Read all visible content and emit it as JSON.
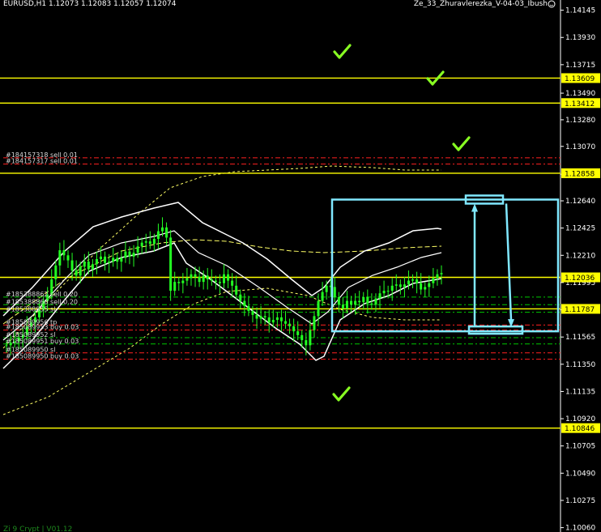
{
  "header": {
    "symbol_line": "EURUSD,H1  1.12073 1.12083 1.12057 1.12074",
    "ea_name": "Ze_33_Zhuravlerezka_V-04-03_Ibush",
    "face_icon": "smiley-icon"
  },
  "footer": {
    "text": "Zi 9 Crypt | V01.12"
  },
  "colors": {
    "background": "#000000",
    "axis_text": "#ffffff",
    "level_line": "#ffff00",
    "bollinger": "#ffffff",
    "ma_dashed": "#ffff66",
    "candles": "#22ff22",
    "order_green": "#00c800",
    "order_red": "#ff2020",
    "box": "#80e8ff",
    "check": "#88ff22"
  },
  "chart_data": {
    "type": "candlestick",
    "symbol": "EURUSD",
    "timeframe": "H1",
    "ylim": [
      1.1,
      1.142
    ],
    "y_ticks": [
      "1.14145",
      "1.13930",
      "1.13715",
      "1.13490",
      "1.13280",
      "1.13070",
      "1.12850",
      "1.12640",
      "1.12425",
      "1.12210",
      "1.11995",
      "1.11780",
      "1.11565",
      "1.11350",
      "1.11135",
      "1.10920",
      "1.10705",
      "1.10490",
      "1.10275",
      "1.10060"
    ],
    "levels": [
      {
        "price": 1.13609,
        "label": "1.13609"
      },
      {
        "price": 1.13412,
        "label": "1.13412"
      },
      {
        "price": 1.12858,
        "label": "1.12858"
      },
      {
        "price": 1.12036,
        "label": "1.12036"
      },
      {
        "price": 1.11787,
        "label": "1.11787"
      },
      {
        "price": 1.10846,
        "label": "1.10846"
      }
    ],
    "orders": [
      {
        "label": "#184157318 sell 0.01",
        "price": 1.1298,
        "color": "red"
      },
      {
        "label": "#184157317 sell 0.01",
        "price": 1.1293,
        "color": "red"
      },
      {
        "label": "#185388862 sell 0.20",
        "price": 1.1188,
        "color": "green"
      },
      {
        "label": "#185388860 sell 0.20",
        "price": 1.1182,
        "color": "green"
      },
      {
        "label": "#185388855 sl",
        "price": 1.1176,
        "color": "green"
      },
      {
        "label": "#185089956 tp",
        "price": 1.1166,
        "color": "red"
      },
      {
        "label": "#185089953 buy 0.03",
        "price": 1.1162,
        "color": "red"
      },
      {
        "label": "#185089952 sl",
        "price": 1.1156,
        "color": "green"
      },
      {
        "label": "#185089951 buy 0.03",
        "price": 1.1151,
        "color": "green"
      },
      {
        "label": "#185089950 sl",
        "price": 1.1144,
        "color": "red"
      },
      {
        "label": "#185089950 buy 0.03",
        "price": 1.1139,
        "color": "red"
      }
    ],
    "close": [
      1.115,
      1.1152,
      1.1153,
      1.1156,
      1.1158,
      1.1165,
      1.1168,
      1.1172,
      1.1178,
      1.1185,
      1.119,
      1.1202,
      1.1213,
      1.1225,
      1.1221,
      1.1217,
      1.1209,
      1.1205,
      1.1212,
      1.1216,
      1.121,
      1.1214,
      1.1218,
      1.122,
      1.1215,
      1.1216,
      1.1219,
      1.1216,
      1.1219,
      1.1224,
      1.122,
      1.1223,
      1.1228,
      1.1231,
      1.1232,
      1.123,
      1.1234,
      1.124,
      1.1243,
      1.1235,
      1.1193,
      1.12,
      1.1199,
      1.1201,
      1.1203,
      1.1206,
      1.1204,
      1.12,
      1.1205,
      1.1202,
      1.1201,
      1.12,
      1.1199,
      1.1206,
      1.1201,
      1.1197,
      1.119,
      1.1185,
      1.1181,
      1.1177,
      1.1174,
      1.1171,
      1.1173,
      1.1172,
      1.1168,
      1.117,
      1.1172,
      1.1169,
      1.1167,
      1.1165,
      1.1161,
      1.1158,
      1.1154,
      1.115,
      1.1162,
      1.1173,
      1.1185,
      1.1192,
      1.1197,
      1.1196,
      1.1188,
      1.1182,
      1.1179,
      1.1185,
      1.1182,
      1.1185,
      1.1184,
      1.1188,
      1.1183,
      1.1182,
      1.1187,
      1.1191,
      1.1193,
      1.1193,
      1.1197,
      1.1198,
      1.1196,
      1.1198,
      1.1201,
      1.1202,
      1.1199,
      1.1194,
      1.1196,
      1.1199,
      1.1203,
      1.1206,
      1.1207
    ],
    "bb_upper_points": [
      [
        4,
        390
      ],
      [
        40,
        355
      ],
      [
        80,
        310
      ],
      [
        115,
        280
      ],
      [
        150,
        268
      ],
      [
        190,
        257
      ],
      [
        220,
        250
      ],
      [
        250,
        275
      ],
      [
        280,
        290
      ],
      [
        300,
        300
      ],
      [
        330,
        320
      ],
      [
        360,
        345
      ],
      [
        385,
        365
      ],
      [
        400,
        355
      ],
      [
        420,
        330
      ],
      [
        450,
        310
      ],
      [
        480,
        300
      ],
      [
        510,
        285
      ],
      [
        540,
        282
      ],
      [
        545,
        283
      ]
    ],
    "bb_lower_points": [
      [
        4,
        455
      ],
      [
        40,
        420
      ],
      [
        80,
        370
      ],
      [
        110,
        335
      ],
      [
        150,
        318
      ],
      [
        190,
        310
      ],
      [
        215,
        300
      ],
      [
        230,
        325
      ],
      [
        260,
        345
      ],
      [
        300,
        375
      ],
      [
        340,
        405
      ],
      [
        370,
        425
      ],
      [
        390,
        445
      ],
      [
        400,
        440
      ],
      [
        420,
        395
      ],
      [
        450,
        375
      ],
      [
        480,
        365
      ],
      [
        510,
        350
      ],
      [
        540,
        345
      ],
      [
        545,
        344
      ]
    ],
    "bb_mid_points": [
      [
        4,
        420
      ],
      [
        40,
        390
      ],
      [
        80,
        345
      ],
      [
        110,
        315
      ],
      [
        150,
        300
      ],
      [
        190,
        292
      ],
      [
        215,
        285
      ],
      [
        245,
        312
      ],
      [
        280,
        328
      ],
      [
        320,
        355
      ],
      [
        355,
        380
      ],
      [
        385,
        400
      ],
      [
        405,
        385
      ],
      [
        430,
        355
      ],
      [
        460,
        340
      ],
      [
        490,
        330
      ],
      [
        520,
        318
      ],
      [
        545,
        312
      ]
    ],
    "ma_upper_points": [
      [
        4,
        430
      ],
      [
        60,
        370
      ],
      [
        120,
        310
      ],
      [
        170,
        265
      ],
      [
        210,
        232
      ],
      [
        250,
        218
      ],
      [
        290,
        212
      ],
      [
        330,
        210
      ],
      [
        370,
        208
      ],
      [
        410,
        205
      ],
      [
        460,
        207
      ],
      [
        500,
        210
      ],
      [
        545,
        210
      ]
    ],
    "ma_mid_points": [
      [
        4,
        400
      ],
      [
        80,
        345
      ],
      [
        150,
        310
      ],
      [
        200,
        300
      ],
      [
        240,
        296
      ],
      [
        280,
        298
      ],
      [
        320,
        305
      ],
      [
        360,
        310
      ],
      [
        400,
        312
      ],
      [
        450,
        310
      ],
      [
        500,
        306
      ],
      [
        545,
        304
      ]
    ],
    "ma_lower_points": [
      [
        4,
        512
      ],
      [
        60,
        490
      ],
      [
        110,
        460
      ],
      [
        160,
        430
      ],
      [
        200,
        400
      ],
      [
        240,
        375
      ],
      [
        280,
        360
      ],
      [
        330,
        356
      ],
      [
        380,
        365
      ],
      [
        420,
        382
      ],
      [
        460,
        392
      ],
      [
        500,
        395
      ],
      [
        545,
        395
      ]
    ],
    "checkmarks": [
      [
        422,
        64
      ],
      [
        537,
        97
      ],
      [
        569,
        178
      ],
      [
        421,
        487
      ]
    ],
    "box": {
      "price_top": 1.1265,
      "price_bottom": 1.1161
    }
  }
}
